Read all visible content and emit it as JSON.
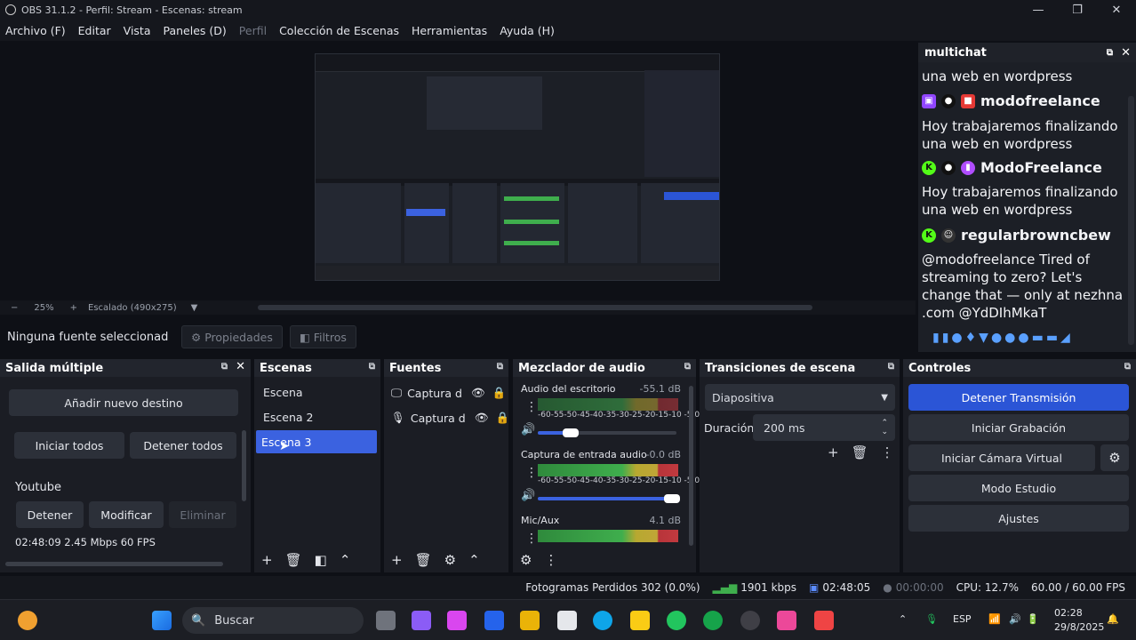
{
  "window": {
    "title": "OBS 31.1.2 - Perfil: Stream - Escenas: stream"
  },
  "menu": [
    "Archivo (F)",
    "Editar",
    "Vista",
    "Paneles (D)",
    "Perfil",
    "Colección de Escenas",
    "Herramientas",
    "Ayuda (H)"
  ],
  "preview": {
    "zoom_minus": "−",
    "zoom": "25%",
    "zoom_plus": "+",
    "scale": "Escalado (490x275)"
  },
  "source_bar": {
    "no_selection": "Ninguna fuente seleccionad",
    "properties": "Propiedades",
    "filters": "Filtros"
  },
  "multichat": {
    "title": "multichat",
    "top_cut": "Hoy trabajaremos finalizando una web en wordpress",
    "top_cut_line2": "una web en wordpress",
    "messages": [
      {
        "user": "modofreelance",
        "line1": "Hoy trabajaremos finalizando",
        "line2": "una web en wordpress"
      },
      {
        "user": "ModoFreelance",
        "line1": "Hoy trabajaremos finalizando",
        "line2": "una web en wordpress"
      },
      {
        "user": "regularbrowncbew",
        "line1": "@modofreelance Tired of",
        "line2": "streaming to zero? Let's",
        "line3": "change that — only at nezhna",
        "line4": ".com @YdDIhMkaT"
      }
    ]
  },
  "salida": {
    "title": "Salida múltiple",
    "add": "Añadir nuevo destino",
    "start_all": "Iniciar todos",
    "stop_all": "Detener todos",
    "target": "Youtube",
    "stop": "Detener",
    "modify": "Modificar",
    "remove": "Eliminar",
    "stats": "02:48:09  2.45 Mbps  60 FPS"
  },
  "escenas": {
    "title": "Escenas",
    "items": [
      "Escena",
      "Escena 2",
      "Escena 3"
    ]
  },
  "fuentes": {
    "title": "Fuentes",
    "items": [
      "Captura d",
      "Captura d"
    ]
  },
  "mezclador": {
    "title": "Mezclador de audio",
    "channels": [
      {
        "name": "Audio del escritorio",
        "db": "-55.1 dB",
        "level": 0.18
      },
      {
        "name": "Captura de entrada audio",
        "db": "-0.0 dB",
        "level": 1.0
      },
      {
        "name": "Mic/Aux",
        "db": "4.1 dB",
        "level": 1.0
      }
    ],
    "scale": "-60-55-50-45-40-35-30-25-20-15-10 -5  0"
  },
  "transiciones": {
    "title": "Transiciones de escena",
    "selected": "Diapositiva",
    "duration_label": "Duración",
    "duration": "200 ms"
  },
  "controles": {
    "title": "Controles",
    "stop_stream": "Detener Transmisión",
    "start_rec": "Iniciar Grabación",
    "virtual_cam": "Iniciar Cámara Virtual",
    "studio": "Modo Estudio",
    "settings": "Ajustes"
  },
  "status": {
    "dropped": "Fotogramas Perdidos 302 (0.0%)",
    "bitrate": "1901 kbps",
    "stream_time": "02:48:05",
    "rec_time": "00:00:00",
    "cpu": "CPU: 12.7%",
    "fps": "60.00 / 60.00 FPS"
  },
  "taskbar": {
    "search": "Buscar",
    "lang": "ESP",
    "time": "02:28",
    "date": "29/8/2025"
  },
  "colors": {
    "accent": "#3b62e0",
    "stream_btn": "#2b55d6",
    "panel": "#1b1d24",
    "bg": "#0e1016"
  }
}
